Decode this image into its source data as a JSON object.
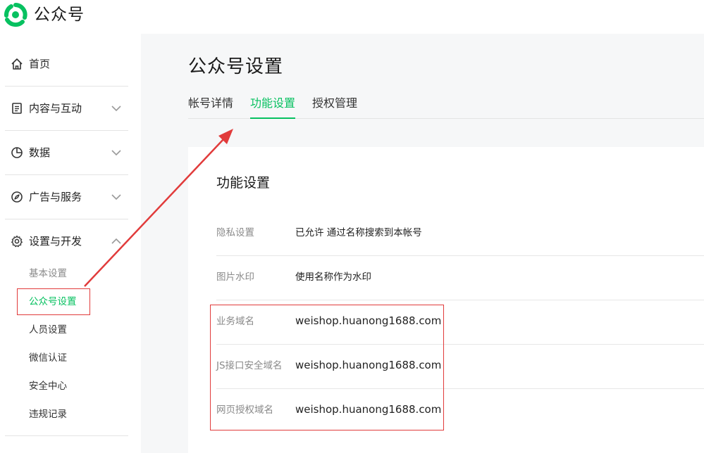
{
  "app": {
    "brand": "公众号"
  },
  "sidebar": {
    "groups": [
      {
        "label": "首页",
        "icon": "home-icon"
      },
      {
        "label": "内容与互动",
        "icon": "document-icon"
      },
      {
        "label": "数据",
        "icon": "chart-icon"
      },
      {
        "label": "广告与服务",
        "icon": "compass-icon"
      },
      {
        "label": "设置与开发",
        "icon": "gear-icon"
      }
    ],
    "subitems": [
      {
        "label": "基本设置",
        "state": "muted"
      },
      {
        "label": "公众号设置",
        "state": "active"
      },
      {
        "label": "人员设置",
        "state": "normal"
      },
      {
        "label": "微信认证",
        "state": "normal"
      },
      {
        "label": "安全中心",
        "state": "normal"
      },
      {
        "label": "违规记录",
        "state": "normal"
      }
    ]
  },
  "main": {
    "title": "公众号设置",
    "tabs": [
      {
        "label": "帐号详情",
        "active": false
      },
      {
        "label": "功能设置",
        "active": true
      },
      {
        "label": "授权管理",
        "active": false
      }
    ],
    "card": {
      "title": "功能设置",
      "rows": [
        {
          "key": "隐私设置",
          "value": "已允许 通过名称搜索到本帐号"
        },
        {
          "key": "图片水印",
          "value": "使用名称作为水印"
        },
        {
          "key": "业务域名",
          "value": "weishop.huanong1688.com"
        },
        {
          "key": "JS接口安全域名",
          "value": "weishop.huanong1688.com"
        },
        {
          "key": "网页授权域名",
          "value": "weishop.huanong1688.com"
        }
      ]
    }
  },
  "colors": {
    "accent": "#07c160",
    "annotation": "#e13b3b"
  }
}
